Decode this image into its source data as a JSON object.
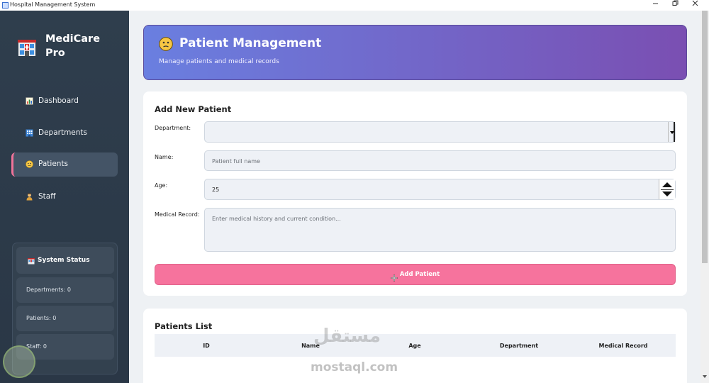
{
  "window": {
    "title": "Hospital Management System",
    "min_icon": "minimize-icon",
    "restore_icon": "restore-icon",
    "close_icon": "close-icon"
  },
  "sidebar": {
    "brand_line1": "MediCare",
    "brand_line2": "Pro",
    "logo_icon": "hospital-icon",
    "items": [
      {
        "label": "Dashboard",
        "icon": "bar-chart-icon"
      },
      {
        "label": "Departments",
        "icon": "building-icon"
      },
      {
        "label": "Patients",
        "icon": "face-icon",
        "active": true
      },
      {
        "label": "Staff",
        "icon": "person-icon"
      }
    ],
    "status": {
      "title": "System Status",
      "rows": [
        "Departments: 0",
        "Patients: 0",
        "Staff: 0"
      ]
    }
  },
  "header": {
    "title": "Patient Management",
    "subtitle": "Manage patients and medical records"
  },
  "form": {
    "title": "Add New Patient",
    "department_label": "Department:",
    "department_value": "",
    "name_label": "Name:",
    "name_placeholder": "Patient full name",
    "age_label": "Age:",
    "age_value": "25",
    "record_label": "Medical Record:",
    "record_placeholder": "Enter medical history and current condition...",
    "add_button": "Add Patient"
  },
  "list": {
    "title": "Patients List",
    "columns": [
      "ID",
      "Name",
      "Age",
      "Department",
      "Medical Record"
    ]
  },
  "watermark": {
    "arabic": "مستقل",
    "url": "mostaql.com"
  },
  "colors": {
    "sidebar_bg": "#2f3e4d",
    "accent_pink": "#f6739d",
    "header_start": "#6a7fe0",
    "header_end": "#7a4fb2"
  }
}
